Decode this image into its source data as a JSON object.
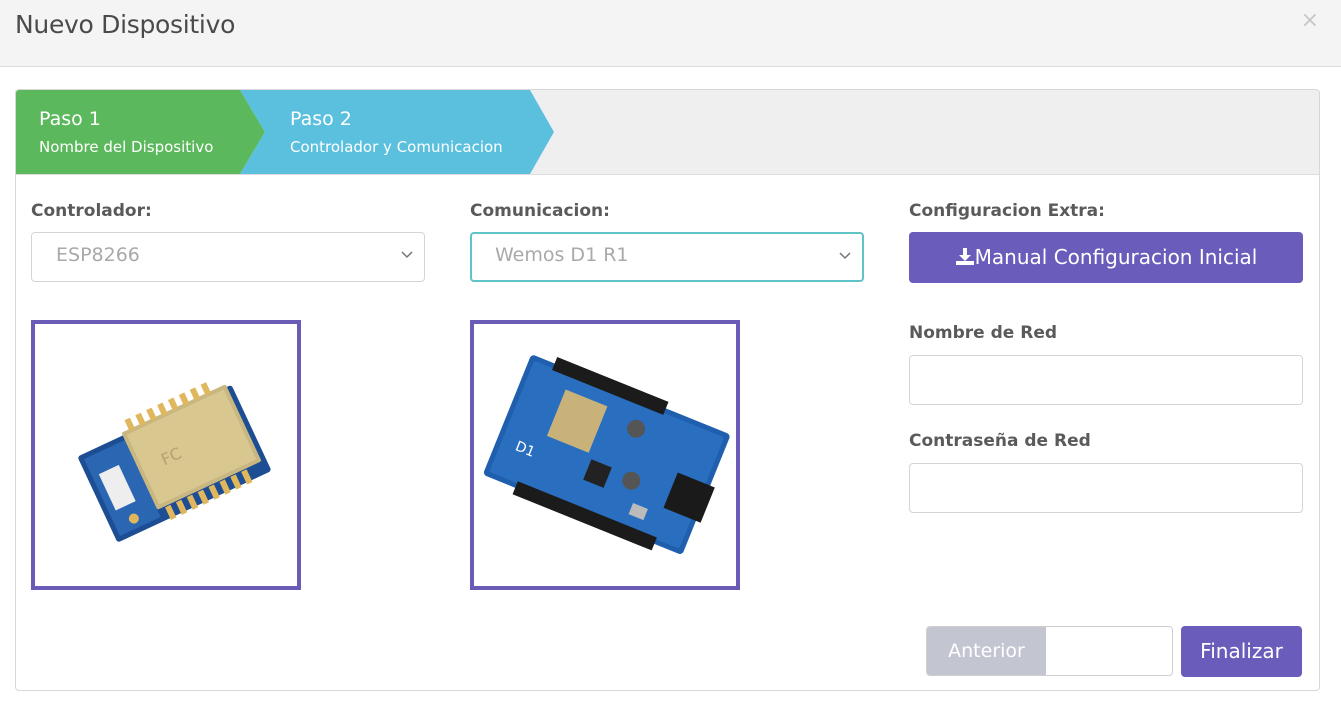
{
  "modal": {
    "title": "Nuevo Dispositivo",
    "close_symbol": "×"
  },
  "steps": [
    {
      "number": "Paso 1",
      "description": "Nombre del Dispositivo",
      "color": "#5cb85c"
    },
    {
      "number": "Paso 2",
      "description": "Controlador y Comunicacion",
      "color": "#5bc0de"
    }
  ],
  "controller": {
    "label": "Controlador:",
    "selected": "ESP8266",
    "icon": "chevron-down-icon"
  },
  "communication": {
    "label": "Comunicacion:",
    "selected": "Wemos D1 R1",
    "icon": "chevron-down-icon"
  },
  "extra": {
    "label": "Configuracion Extra:",
    "manual_button": "Manual Configuracion Inicial",
    "manual_icon": "download-icon"
  },
  "network": {
    "name_label": "Nombre de Red",
    "name_value": "",
    "password_label": "Contraseña de Red",
    "password_value": ""
  },
  "footer": {
    "prev_label": "Anterior",
    "finish_label": "Finalizar"
  },
  "colors": {
    "accent": "#6a5cba",
    "step1": "#5cb85c",
    "step2": "#5bc0de",
    "focus": "#5fc3c7"
  }
}
